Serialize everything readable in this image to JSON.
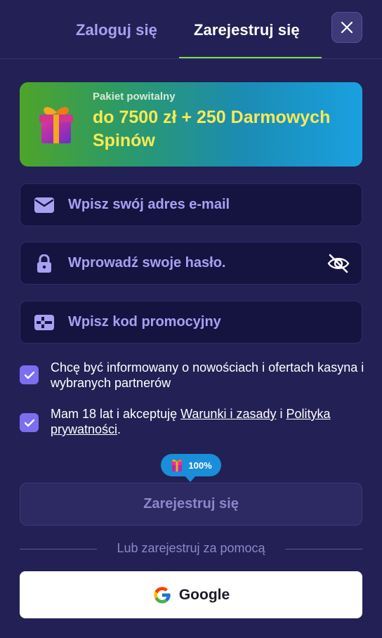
{
  "tabs": {
    "login": "Zaloguj się",
    "register": "Zarejestruj się",
    "active": "register",
    "accent_color": "#7edc4a"
  },
  "close_icon": "close-icon",
  "banner": {
    "subtitle": "Pakiet powitalny",
    "title": "do 7500 zł + 250 Darmowych Spinów",
    "icon": "gift-icon"
  },
  "fields": {
    "email": {
      "placeholder": "Wpisz swój adres e-mail",
      "value": "",
      "icon": "mail-icon"
    },
    "password": {
      "placeholder": "Wprowadź swoje hasło.",
      "value": "",
      "icon": "lock-icon",
      "toggle_icon": "eye-off-icon"
    },
    "promo": {
      "placeholder": "Wpisz kod promocyjny",
      "value": "",
      "icon": "ticket-icon"
    }
  },
  "consents": {
    "marketing": {
      "checked": true,
      "text": "Chcę być informowany o nowościach i ofertach kasyna i wybranych partnerów"
    },
    "terms": {
      "checked": true,
      "text_before": "Mam 18 lat i akceptuję ",
      "terms_link": "Warunki i zasady",
      "text_middle": " i ",
      "privacy_link": "Polityka prywatności",
      "text_after": "."
    }
  },
  "bonus_pill": {
    "label": "100%",
    "icon": "gift-icon",
    "percent": 100
  },
  "register_button": "Zarejestruj się",
  "divider_text": "Lub zarejestruj za pomocą",
  "google_button": {
    "label": "Google",
    "icon": "google-icon"
  },
  "colors": {
    "background": "#232055",
    "field_background": "#151340",
    "placeholder": "#a9a0f2",
    "checkbox": "#7b6ef0",
    "banner_text": "#f7ea55",
    "pill": "#1a8ed8"
  }
}
